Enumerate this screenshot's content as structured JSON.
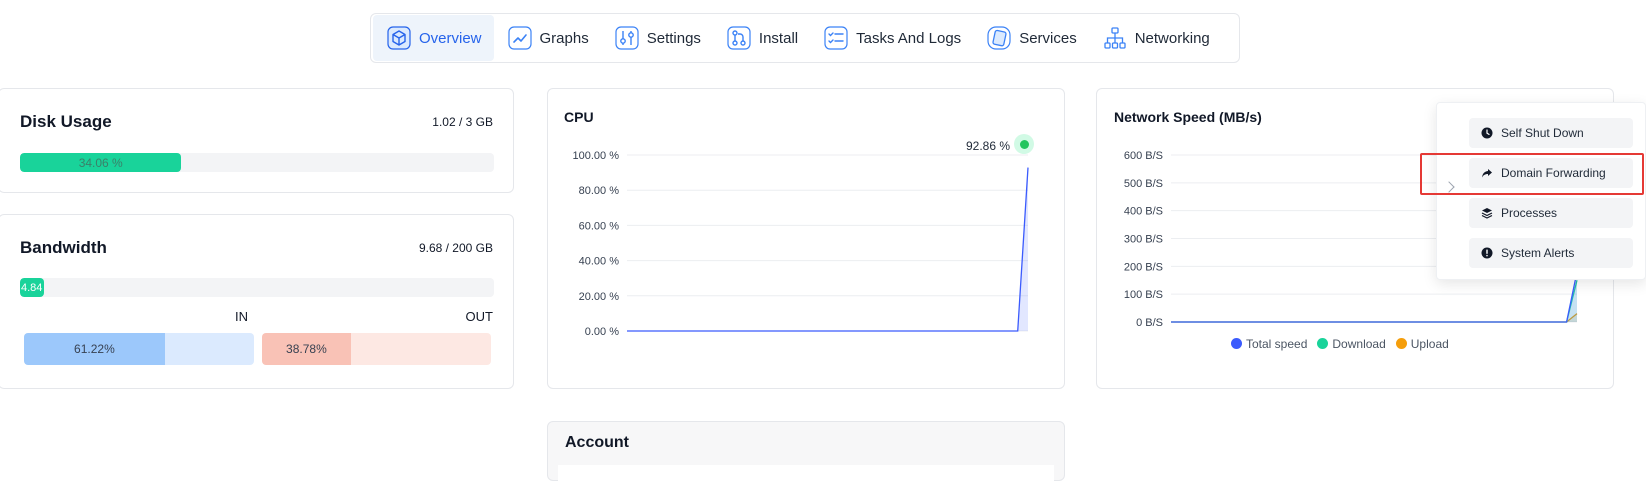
{
  "tabs": [
    {
      "label": "Overview",
      "icon": "cube-icon",
      "active": true
    },
    {
      "label": "Graphs",
      "icon": "line-chart-icon"
    },
    {
      "label": "Settings",
      "icon": "sliders-icon"
    },
    {
      "label": "Install",
      "icon": "git-branch-icon"
    },
    {
      "label": "Tasks And Logs",
      "icon": "checklist-icon"
    },
    {
      "label": "Services",
      "icon": "service-icon"
    },
    {
      "label": "Networking",
      "icon": "network-icon"
    }
  ],
  "disk": {
    "title": "Disk Usage",
    "value": "1.02 / 3 GB",
    "percent_label": "34.06 %",
    "percent": 34.06
  },
  "bandwidth": {
    "title": "Bandwidth",
    "value": "9.68 / 200 GB",
    "percent_label": "4.84",
    "percent": 4.84,
    "in_label": "IN",
    "out_label": "OUT",
    "in_percent_label": "61.22%",
    "in_percent": 61.22,
    "out_percent_label": "38.78%",
    "out_percent": 38.78
  },
  "cpu": {
    "title": "CPU",
    "current": "92.86 %"
  },
  "network": {
    "title": "Network Speed (MB/s)"
  },
  "account": {
    "title": "Account"
  },
  "dropdown": {
    "items": [
      {
        "label": "Self Shut Down",
        "icon": "clock-icon"
      },
      {
        "label": "Domain Forwarding",
        "icon": "share-icon",
        "highlighted": true
      },
      {
        "label": "Processes",
        "icon": "layers-icon"
      },
      {
        "label": "System Alerts",
        "icon": "alert-icon"
      }
    ]
  },
  "colors": {
    "accent": "#2563eb",
    "green": "#19d39a",
    "highlight": "#e53935",
    "orange": "#f59e0b"
  },
  "chart_data": [
    {
      "type": "line",
      "title": "CPU",
      "y_ticks": [
        "100.00 %",
        "80.00 %",
        "60.00 %",
        "40.00 %",
        "20.00 %",
        "0.00 %"
      ],
      "ylim": [
        0,
        100
      ],
      "annotation": "92.86 %",
      "series": [
        {
          "values": [
            0,
            0,
            0,
            0,
            0,
            0,
            0,
            0,
            0,
            0,
            0,
            0,
            0,
            0,
            0,
            0,
            0,
            0,
            0,
            0,
            0,
            0,
            0,
            0,
            0,
            0,
            0,
            0,
            0,
            0,
            0,
            0,
            0,
            0,
            0,
            0,
            0,
            0,
            0,
            92.86
          ]
        }
      ]
    },
    {
      "type": "area",
      "title": "Network Speed (MB/s)",
      "y_ticks": [
        "600 B/S",
        "500 B/S",
        "400 B/S",
        "300 B/S",
        "200 B/S",
        "100 B/S",
        "0 B/S"
      ],
      "ylim": [
        0,
        600
      ],
      "legend": "bottom",
      "series": [
        {
          "name": "Total speed",
          "color": "#3b5bfd",
          "values": [
            0,
            0,
            0,
            0,
            0,
            0,
            0,
            0,
            0,
            0,
            0,
            0,
            0,
            0,
            0,
            0,
            0,
            0,
            0,
            0,
            0,
            0,
            0,
            0,
            0,
            0,
            0,
            0,
            0,
            0,
            0,
            0,
            0,
            0,
            0,
            0,
            0,
            0,
            0,
            180
          ]
        },
        {
          "name": "Download",
          "color": "#19d39a",
          "values": [
            0,
            0,
            0,
            0,
            0,
            0,
            0,
            0,
            0,
            0,
            0,
            0,
            0,
            0,
            0,
            0,
            0,
            0,
            0,
            0,
            0,
            0,
            0,
            0,
            0,
            0,
            0,
            0,
            0,
            0,
            0,
            0,
            0,
            0,
            0,
            0,
            0,
            0,
            0,
            150
          ]
        },
        {
          "name": "Upload",
          "color": "#f59e0b",
          "values": [
            0,
            0,
            0,
            0,
            0,
            0,
            0,
            0,
            0,
            0,
            0,
            0,
            0,
            0,
            0,
            0,
            0,
            0,
            0,
            0,
            0,
            0,
            0,
            0,
            0,
            0,
            0,
            0,
            0,
            0,
            0,
            0,
            0,
            0,
            0,
            0,
            0,
            0,
            0,
            30
          ]
        }
      ]
    }
  ]
}
